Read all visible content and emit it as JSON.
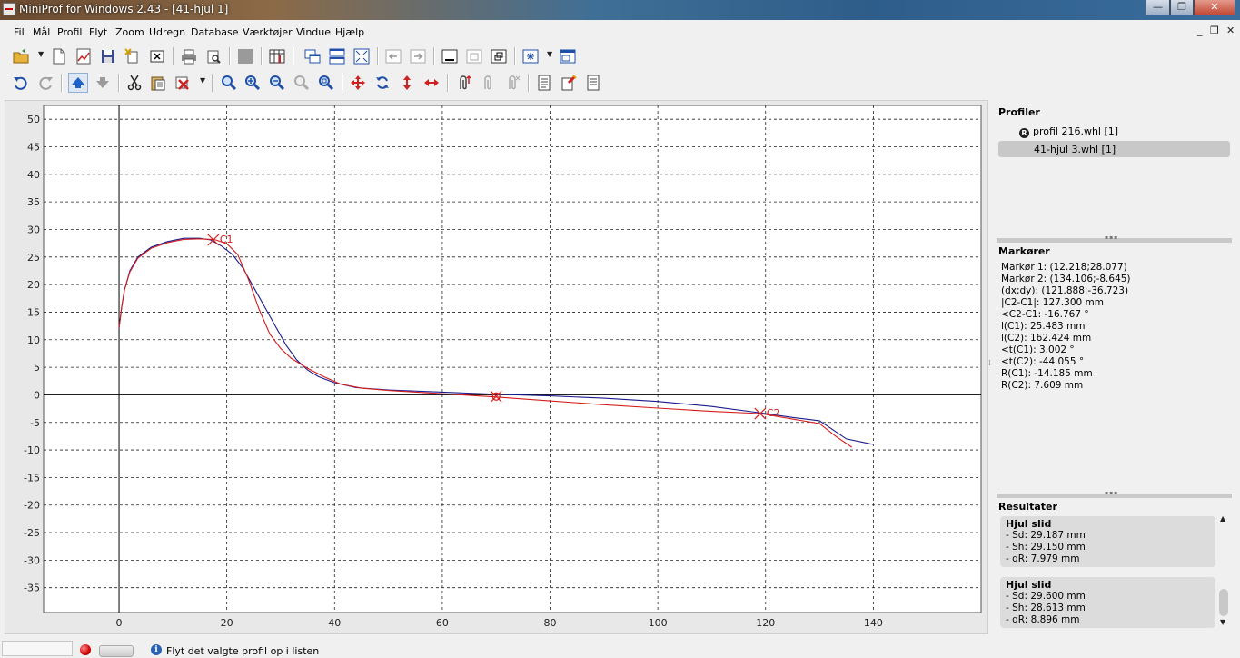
{
  "window": {
    "title": "MiniProf for Windows 2.43 - [41-hjul 1]",
    "min_glyph": "—",
    "max_glyph": "❐",
    "close_glyph": "✕"
  },
  "menu": {
    "items": [
      "Fil",
      "Mål",
      "Profil",
      "Flyt",
      "Zoom",
      "Udregn",
      "Database",
      "Værktøjer",
      "Vindue",
      "Hjælp"
    ],
    "mdi_min": "_",
    "mdi_restore": "❐",
    "mdi_close": "✕"
  },
  "chart_data": {
    "type": "line",
    "x_ticks": [
      0,
      20,
      40,
      60,
      80,
      100,
      120,
      140
    ],
    "y_ticks": [
      50,
      45,
      40,
      35,
      30,
      25,
      20,
      15,
      10,
      5,
      0,
      -5,
      -10,
      -15,
      -20,
      -25,
      -30,
      -35
    ],
    "xlim": [
      -14,
      160
    ],
    "ylim": [
      -39.5,
      52.5
    ],
    "grid": "dashed",
    "series": [
      {
        "color": "#1a1a8c",
        "x": [
          0,
          0.5,
          1,
          2,
          3.5,
          6,
          9,
          12,
          15,
          17,
          19,
          21,
          23,
          25,
          27,
          29,
          31,
          33,
          35,
          37,
          40,
          44,
          50,
          60,
          70,
          80,
          90,
          100,
          110,
          120,
          125,
          130,
          132,
          135,
          138,
          140
        ],
        "y": [
          12,
          16,
          19,
          22.5,
          25,
          26.8,
          27.8,
          28.4,
          28.4,
          28.1,
          27,
          25.5,
          23,
          19.5,
          16,
          12.5,
          9,
          6.3,
          4.5,
          3.3,
          2.2,
          1.3,
          0.9,
          0.5,
          0.1,
          -0.2,
          -0.6,
          -1.2,
          -2.1,
          -3.4,
          -4.1,
          -4.7,
          -6,
          -8,
          -8.6,
          -9
        ]
      },
      {
        "color": "#d51c1c",
        "x": [
          0,
          0.5,
          1,
          2,
          3.5,
          6,
          9,
          12,
          15,
          17,
          18,
          20,
          22,
          24,
          26,
          28,
          30,
          32,
          35,
          38,
          41,
          45,
          50,
          60,
          70,
          80,
          90,
          100,
          110,
          119,
          125,
          130,
          133,
          136
        ],
        "y": [
          12,
          16,
          19,
          22.3,
          24.8,
          26.6,
          27.6,
          28.2,
          28.3,
          28.2,
          28.1,
          27.4,
          25.5,
          21,
          15.5,
          11,
          8.4,
          6.6,
          4.8,
          3.3,
          2,
          1.2,
          0.8,
          0.2,
          -0.4,
          -1.1,
          -1.8,
          -2.4,
          -3,
          -3.4,
          -4.4,
          -5.2,
          -7.5,
          -9.5
        ]
      }
    ],
    "markers": [
      {
        "label": "C1",
        "x": 17.5,
        "y": 28.1
      },
      {
        "label": "",
        "x": 70,
        "y": -0.3
      },
      {
        "label": "C2",
        "x": 119,
        "y": -3.4
      }
    ]
  },
  "side": {
    "profiles_title": "Profiler",
    "ref_badge": "R",
    "ref_profile": "profil 216.whl [1]",
    "sel_profile": "41-hjul 3.whl [1]",
    "markers_title": "Markører",
    "markers": [
      "Markør 1: (12.218;28.077)",
      "Markør 2: (134.106;-8.645)",
      "(dx;dy): (121.888;-36.723)",
      "|C2-C1|: 127.300 mm",
      "<C2-C1: -16.767 °",
      "l(C1): 25.483 mm",
      "l(C2): 162.424 mm",
      "<t(C1): 3.002 °",
      "<t(C2): -44.055 °",
      "R(C1): -14.185 mm",
      "R(C2): 7.609 mm"
    ],
    "results_title": "Resultater",
    "results": [
      {
        "title": "Hjul slid",
        "sd": "- Sd: 29.187 mm",
        "sh": "- Sh: 29.150 mm",
        "qr": "- qR: 7.979 mm"
      },
      {
        "title": "Hjul slid",
        "sd": "- Sd: 29.600 mm",
        "sh": "- Sh: 28.613 mm",
        "qr": "- qR: 8.896 mm"
      }
    ],
    "scroll_up": "▲",
    "scroll_down": "▼"
  },
  "status": {
    "info_glyph": "i",
    "text": "Flyt det valgte profil op i listen"
  }
}
